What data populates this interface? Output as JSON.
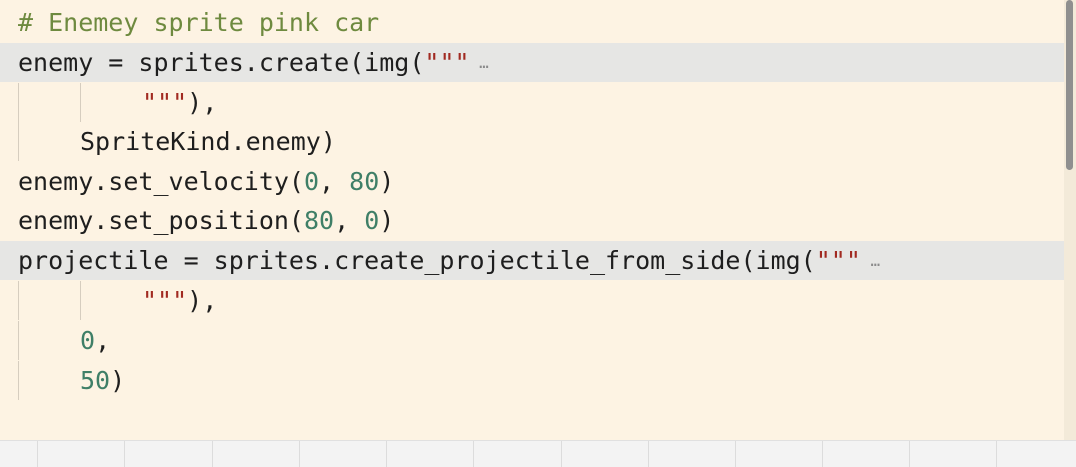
{
  "editor": {
    "lines": [
      {
        "parts": [
          {
            "text": "# Enemey sprite pink car",
            "cls": "cm"
          }
        ]
      },
      {
        "highlight": true,
        "folded": true,
        "parts": [
          {
            "text": "enemy = sprites.create(img(",
            "cls": ""
          },
          {
            "text": "\"\"\"",
            "cls": "str"
          }
        ]
      },
      {
        "indent": 2,
        "parts": [
          {
            "text": "\"\"\"",
            "cls": "str"
          },
          {
            "text": "),",
            "cls": ""
          }
        ]
      },
      {
        "indent": 1,
        "parts": [
          {
            "text": "SpriteKind.enemy)",
            "cls": ""
          }
        ]
      },
      {
        "parts": [
          {
            "text": "enemy.set_velocity(",
            "cls": ""
          },
          {
            "text": "0",
            "cls": "num"
          },
          {
            "text": ", ",
            "cls": ""
          },
          {
            "text": "80",
            "cls": "num"
          },
          {
            "text": ")",
            "cls": ""
          }
        ]
      },
      {
        "parts": [
          {
            "text": "enemy.set_position(",
            "cls": ""
          },
          {
            "text": "80",
            "cls": "num"
          },
          {
            "text": ", ",
            "cls": ""
          },
          {
            "text": "0",
            "cls": "num"
          },
          {
            "text": ")",
            "cls": ""
          }
        ]
      },
      {
        "highlight": true,
        "folded": true,
        "parts": [
          {
            "text": "projectile = sprites.create_projectile_from_side(img(",
            "cls": ""
          },
          {
            "text": "\"\"\"",
            "cls": "str"
          }
        ]
      },
      {
        "indent": 2,
        "parts": [
          {
            "text": "\"\"\"",
            "cls": "str"
          },
          {
            "text": "),",
            "cls": ""
          }
        ]
      },
      {
        "indent": 1,
        "parts": [
          {
            "text": "0",
            "cls": "num"
          },
          {
            "text": ",",
            "cls": ""
          }
        ]
      },
      {
        "indent": 1,
        "parts": [
          {
            "text": "50",
            "cls": "num"
          },
          {
            "text": ")",
            "cls": ""
          }
        ]
      }
    ],
    "fold_ellipsis": "…"
  }
}
